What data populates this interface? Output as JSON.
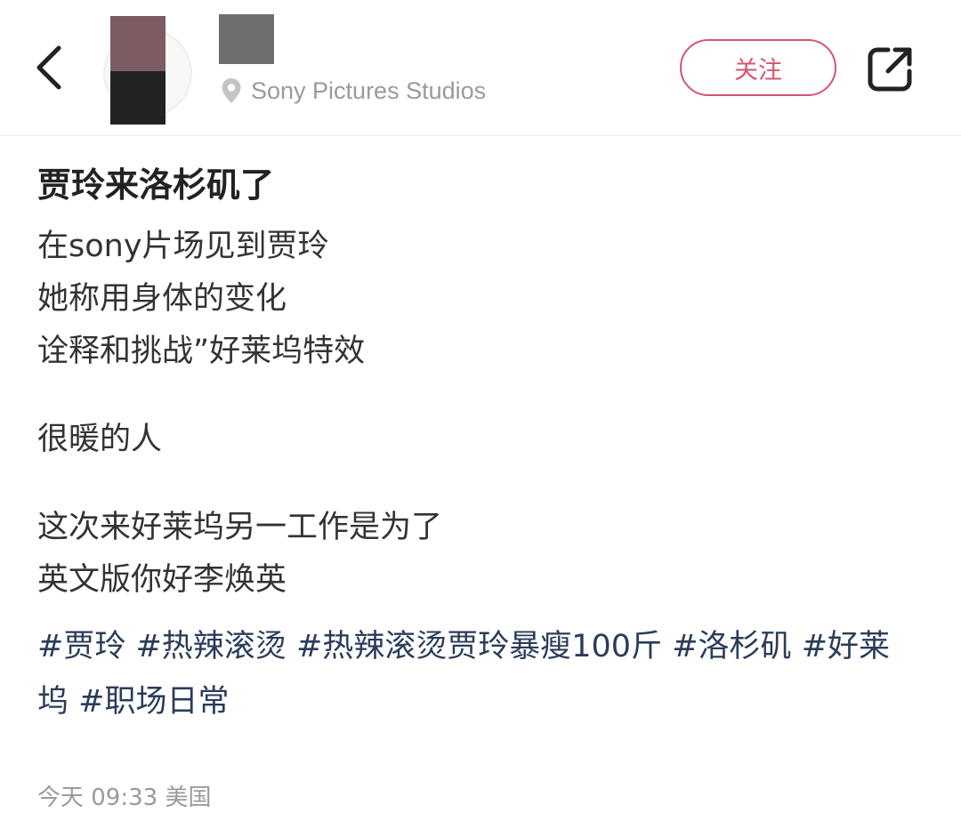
{
  "header": {
    "location": "Sony Pictures Studios",
    "follow_label": "关注",
    "icons": {
      "back": "chevron-left-icon",
      "location": "location-pin-icon",
      "share": "share-external-icon"
    }
  },
  "post": {
    "title": "贾玲来洛杉矶了",
    "paragraphs": [
      [
        "在sony片场见到贾玲",
        "她称用身体的变化",
        "诠释和挑战”好莱坞特效"
      ],
      [
        "很暖的人"
      ],
      [
        "这次来好莱坞另一工作是为了",
        "英文版你好李焕英"
      ]
    ],
    "tags": [
      "#贾玲",
      "#热辣滚烫",
      "#热辣滚烫贾玲暴瘦100斤",
      "#洛杉矶",
      "#好莱坞",
      "#职场日常"
    ],
    "meta": "今天 09:33 美国"
  },
  "colors": {
    "accent": "#d5566e",
    "tag": "#2b3c5a",
    "muted": "#9a9a9a"
  }
}
